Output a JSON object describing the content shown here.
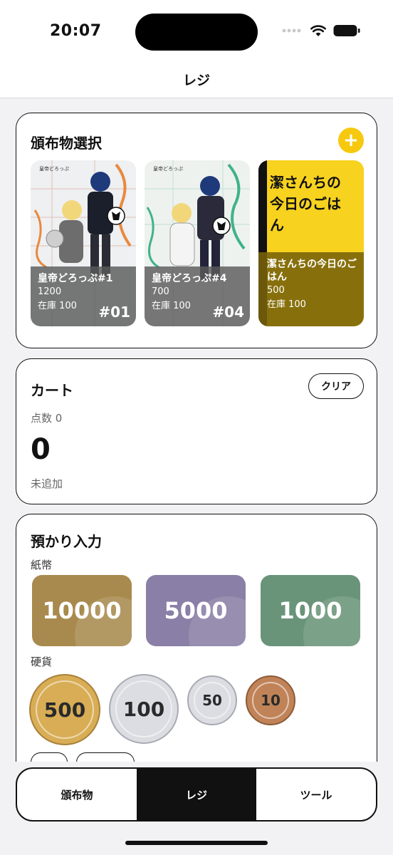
{
  "status": {
    "time": "20:07"
  },
  "nav": {
    "title": "レジ"
  },
  "items_section": {
    "title": "頒布物選択",
    "add_label": "+",
    "items": [
      {
        "name": "皇帝どろっぷ#1",
        "price": "1200",
        "stock": "在庫 100",
        "number": "#01"
      },
      {
        "name": "皇帝どろっぷ#4",
        "price": "700",
        "stock": "在庫 100",
        "number": "#04"
      },
      {
        "cover_text": "潔さんちの今日のごはん",
        "name": "潔さんちの今日のごはん",
        "price": "500",
        "stock": "在庫 100"
      }
    ]
  },
  "cart": {
    "title": "カート",
    "clear_label": "クリア",
    "count": "点数 0",
    "total": "0",
    "empty_text": "未追加"
  },
  "deposit": {
    "title": "預かり入力",
    "bills_label": "紙幣",
    "bills": [
      "10000",
      "5000",
      "1000"
    ],
    "coins_label": "硬貨",
    "coins": [
      "500",
      "100",
      "50",
      "10"
    ],
    "colors": {
      "bill_10000": "#a88a4e",
      "bill_5000": "#8a7fa6",
      "bill_1000": "#6a9479",
      "coin_500": "#d8ad55",
      "coin_100": "#dcdde2",
      "coin_50": "#dcdde2",
      "coin_10": "#c08358"
    }
  },
  "tabs": [
    "頒布物",
    "レジ",
    "ツール"
  ],
  "accent": "#f6c90e"
}
